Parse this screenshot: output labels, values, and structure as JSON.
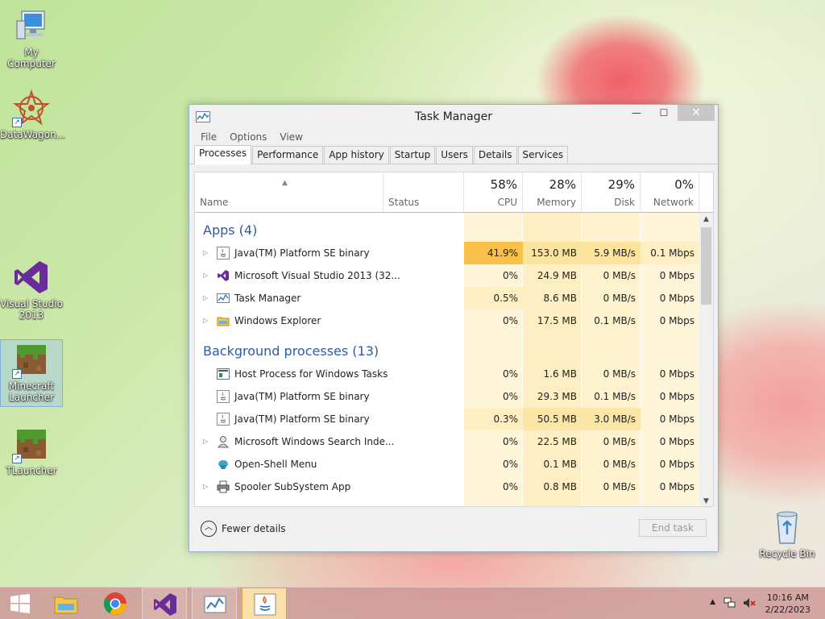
{
  "desktop": {
    "icons": [
      {
        "label": "My Computer"
      },
      {
        "label": "DataWagon..."
      },
      {
        "label": "Visual Studio 2013"
      },
      {
        "label": "Minecraft Launcher"
      },
      {
        "label": "TLauncher"
      },
      {
        "label": "Recycle Bin"
      }
    ]
  },
  "window": {
    "title": "Task Manager",
    "controls": {
      "minimize": "—",
      "maximize": "☐",
      "close": "✕"
    },
    "menu": [
      "File",
      "Options",
      "View"
    ],
    "tabs": [
      "Processes",
      "Performance",
      "App history",
      "Startup",
      "Users",
      "Details",
      "Services"
    ],
    "active_tab": "Processes",
    "columns": {
      "name": "Name",
      "status": "Status",
      "cpu": {
        "pct": "58%",
        "label": "CPU"
      },
      "memory": {
        "pct": "28%",
        "label": "Memory"
      },
      "disk": {
        "pct": "29%",
        "label": "Disk"
      },
      "network": {
        "pct": "0%",
        "label": "Network"
      }
    },
    "groups": {
      "apps": "Apps (4)",
      "background": "Background processes (13)"
    },
    "apps": [
      {
        "name": "Java(TM) Platform SE binary",
        "cpu": "41.9%",
        "memory": "153.0 MB",
        "disk": "5.9 MB/s",
        "network": "0.1 Mbps"
      },
      {
        "name": "Microsoft Visual Studio 2013 (32...",
        "cpu": "0%",
        "memory": "24.9 MB",
        "disk": "0 MB/s",
        "network": "0 Mbps"
      },
      {
        "name": "Task Manager",
        "cpu": "0.5%",
        "memory": "8.6 MB",
        "disk": "0 MB/s",
        "network": "0 Mbps"
      },
      {
        "name": "Windows Explorer",
        "cpu": "0%",
        "memory": "17.5 MB",
        "disk": "0.1 MB/s",
        "network": "0 Mbps"
      }
    ],
    "background": [
      {
        "name": "Host Process for Windows Tasks",
        "cpu": "0%",
        "memory": "1.6 MB",
        "disk": "0 MB/s",
        "network": "0 Mbps"
      },
      {
        "name": "Java(TM) Platform SE binary",
        "cpu": "0%",
        "memory": "29.3 MB",
        "disk": "0.1 MB/s",
        "network": "0 Mbps"
      },
      {
        "name": "Java(TM) Platform SE binary",
        "cpu": "0.3%",
        "memory": "50.5 MB",
        "disk": "3.0 MB/s",
        "network": "0 Mbps"
      },
      {
        "name": "Microsoft Windows Search Inde...",
        "cpu": "0%",
        "memory": "22.5 MB",
        "disk": "0 MB/s",
        "network": "0 Mbps"
      },
      {
        "name": "Open-Shell Menu",
        "cpu": "0%",
        "memory": "0.1 MB",
        "disk": "0 MB/s",
        "network": "0 Mbps"
      },
      {
        "name": "Spooler SubSystem App",
        "cpu": "0%",
        "memory": "0.8 MB",
        "disk": "0 MB/s",
        "network": "0 Mbps"
      }
    ],
    "footer": {
      "fewer_details": "Fewer details",
      "end_task": "End task"
    }
  },
  "taskbar": {
    "clock_time": "10:16 AM",
    "clock_date": "2/22/2023"
  },
  "colors": {
    "cpu_hot": "#f9c04a",
    "col_warm": "#fdefc3",
    "col_light": "#fff6da",
    "group_title": "#2c5ba7"
  }
}
